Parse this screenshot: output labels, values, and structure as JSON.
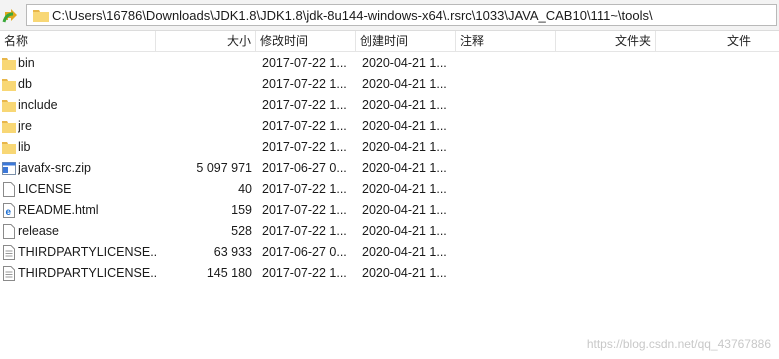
{
  "address": {
    "path": "C:\\Users\\16786\\Downloads\\JDK1.8\\JDK1.8\\jdk-8u144-windows-x64\\.rsrc\\1033\\JAVA_CAB10\\111~\\tools\\"
  },
  "columns": {
    "name": "名称",
    "size": "大小",
    "modified": "修改时间",
    "created": "创建时间",
    "attributes": "注释",
    "owner": "文件夹",
    "group": "文件"
  },
  "files": [
    {
      "name": "bin",
      "size": "",
      "modified": "2017-07-22 1...",
      "created": "2020-04-21 1...",
      "icon": "folder-icon"
    },
    {
      "name": "db",
      "size": "",
      "modified": "2017-07-22 1...",
      "created": "2020-04-21 1...",
      "icon": "folder-icon"
    },
    {
      "name": "include",
      "size": "",
      "modified": "2017-07-22 1...",
      "created": "2020-04-21 1...",
      "icon": "folder-icon"
    },
    {
      "name": "jre",
      "size": "",
      "modified": "2017-07-22 1...",
      "created": "2020-04-21 1...",
      "icon": "folder-icon"
    },
    {
      "name": "lib",
      "size": "",
      "modified": "2017-07-22 1...",
      "created": "2020-04-21 1...",
      "icon": "folder-icon"
    },
    {
      "name": "javafx-src.zip",
      "size": "5 097 971",
      "modified": "2017-06-27 0...",
      "created": "2020-04-21 1...",
      "icon": "zip-icon"
    },
    {
      "name": "LICENSE",
      "size": "40",
      "modified": "2017-07-22 1...",
      "created": "2020-04-21 1...",
      "icon": "file-icon"
    },
    {
      "name": "README.html",
      "size": "159",
      "modified": "2017-07-22 1...",
      "created": "2020-04-21 1...",
      "icon": "html-icon"
    },
    {
      "name": "release",
      "size": "528",
      "modified": "2017-07-22 1...",
      "created": "2020-04-21 1...",
      "icon": "file-icon"
    },
    {
      "name": "THIRDPARTYLICENSE...",
      "size": "63 933",
      "modified": "2017-06-27 0...",
      "created": "2020-04-21 1...",
      "icon": "text-file-icon"
    },
    {
      "name": "THIRDPARTYLICENSE...",
      "size": "145 180",
      "modified": "2017-07-22 1...",
      "created": "2020-04-21 1...",
      "icon": "text-file-icon"
    }
  ],
  "watermark": "https://blog.csdn.net/qq_43767886",
  "colors": {
    "folder": "#f8d775",
    "folder_dark": "#e8b64a",
    "accent": "#3c78d8"
  }
}
